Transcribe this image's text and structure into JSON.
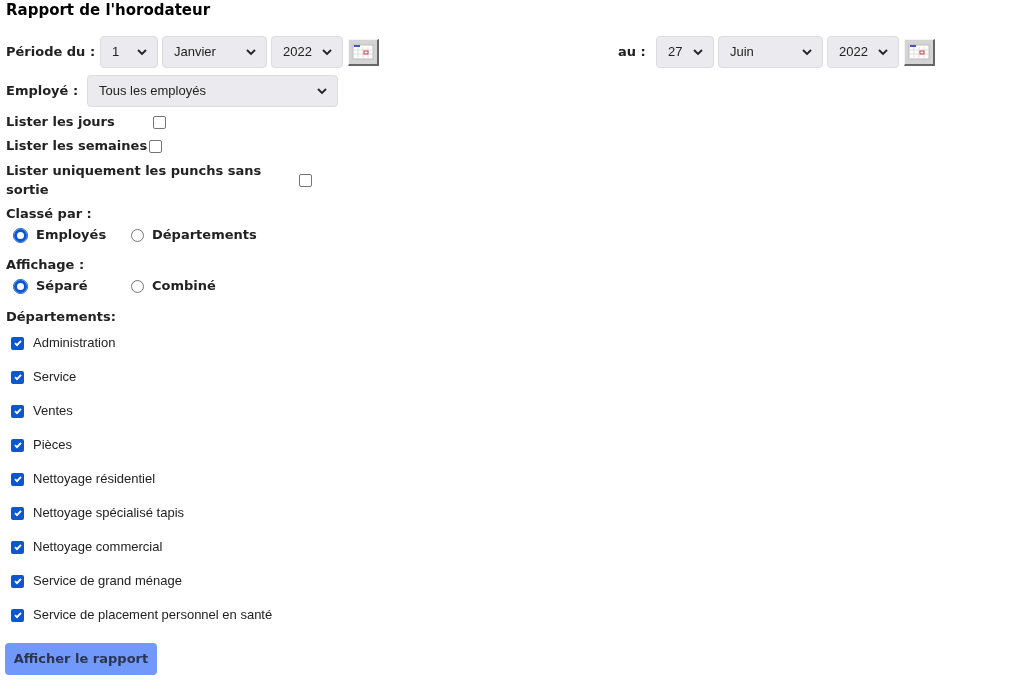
{
  "title": "Rapport de l'horodateur",
  "period": {
    "from_label": "Période du :",
    "from": [
      "1",
      "Janvier",
      "2022"
    ],
    "to_label": "au :",
    "to": [
      "27",
      "Juin",
      "2022"
    ]
  },
  "employee": {
    "label": "Employé :",
    "value": "Tous les employés"
  },
  "options": [
    {
      "label": "Lister les jours",
      "checked": false
    },
    {
      "label": "Lister les semaines",
      "checked": false
    },
    {
      "label": "Lister uniquement les punchs sans sortie",
      "checked": false
    }
  ],
  "sort": {
    "label": "Classé par :",
    "choices": [
      {
        "label": "Employés",
        "selected": true
      },
      {
        "label": "Départements",
        "selected": false
      }
    ]
  },
  "display": {
    "label": "Affichage :",
    "choices": [
      {
        "label": "Séparé",
        "selected": true
      },
      {
        "label": "Combiné",
        "selected": false
      }
    ]
  },
  "departments": {
    "label": "Départements:",
    "items": [
      {
        "label": "Administration",
        "checked": true
      },
      {
        "label": "Service",
        "checked": true
      },
      {
        "label": "Ventes",
        "checked": true
      },
      {
        "label": "Pièces",
        "checked": true
      },
      {
        "label": "Nettoyage résidentiel",
        "checked": true
      },
      {
        "label": "Nettoyage spécialisé tapis",
        "checked": true
      },
      {
        "label": "Nettoyage commercial",
        "checked": true
      },
      {
        "label": "Service de grand ménage",
        "checked": true
      },
      {
        "label": "Service de placement personnel en santé",
        "checked": true
      }
    ]
  },
  "submit": "Afficher le rapport"
}
